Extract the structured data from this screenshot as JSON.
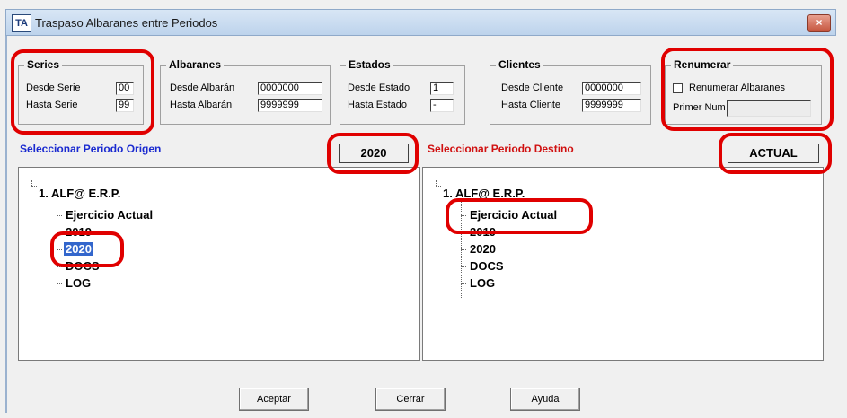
{
  "window": {
    "icon_text": "TA",
    "title": "Traspaso Albaranes entre Periodos",
    "close_glyph": "×"
  },
  "series": {
    "title": "Series",
    "desde_label": "Desde Serie",
    "desde_value": "00",
    "hasta_label": "Hasta Serie",
    "hasta_value": "99"
  },
  "albaranes": {
    "title": "Albaranes",
    "desde_label": "Desde Albarán",
    "desde_value": "0000000",
    "hasta_label": "Hasta Albarán",
    "hasta_value": "9999999"
  },
  "estados": {
    "title": "Estados",
    "desde_label": "Desde Estado",
    "desde_value": "1",
    "hasta_label": "Hasta Estado",
    "hasta_value": "-"
  },
  "clientes": {
    "title": "Clientes",
    "desde_label": "Desde Cliente",
    "desde_value": "0000000",
    "hasta_label": "Hasta Cliente",
    "hasta_value": "9999999"
  },
  "renumerar": {
    "title": "Renumerar",
    "checkbox_label": "Renumerar Albaranes",
    "primer_label": "Primer Num",
    "primer_value": ""
  },
  "origen": {
    "header": "Seleccionar Periodo Origen",
    "header_color": "#1a2ad0",
    "period": "2020",
    "tree": {
      "root": "1. ALF@ E.R.P.",
      "items": [
        "Ejercicio Actual",
        "2019",
        "2020",
        "DOCS",
        "LOG"
      ],
      "selected": "2020"
    }
  },
  "destino": {
    "header": "Seleccionar Periodo Destino",
    "header_color": "#d01010",
    "period": "ACTUAL",
    "tree": {
      "root": "1. ALF@ E.R.P.",
      "items": [
        "Ejercicio Actual",
        "2019",
        "2020",
        "DOCS",
        "LOG"
      ]
    }
  },
  "buttons": {
    "accept": "Aceptar",
    "close": "Cerrar",
    "help": "Ayuda"
  },
  "colors": {
    "highlight": "#e00000",
    "selection": "#3366cc"
  }
}
